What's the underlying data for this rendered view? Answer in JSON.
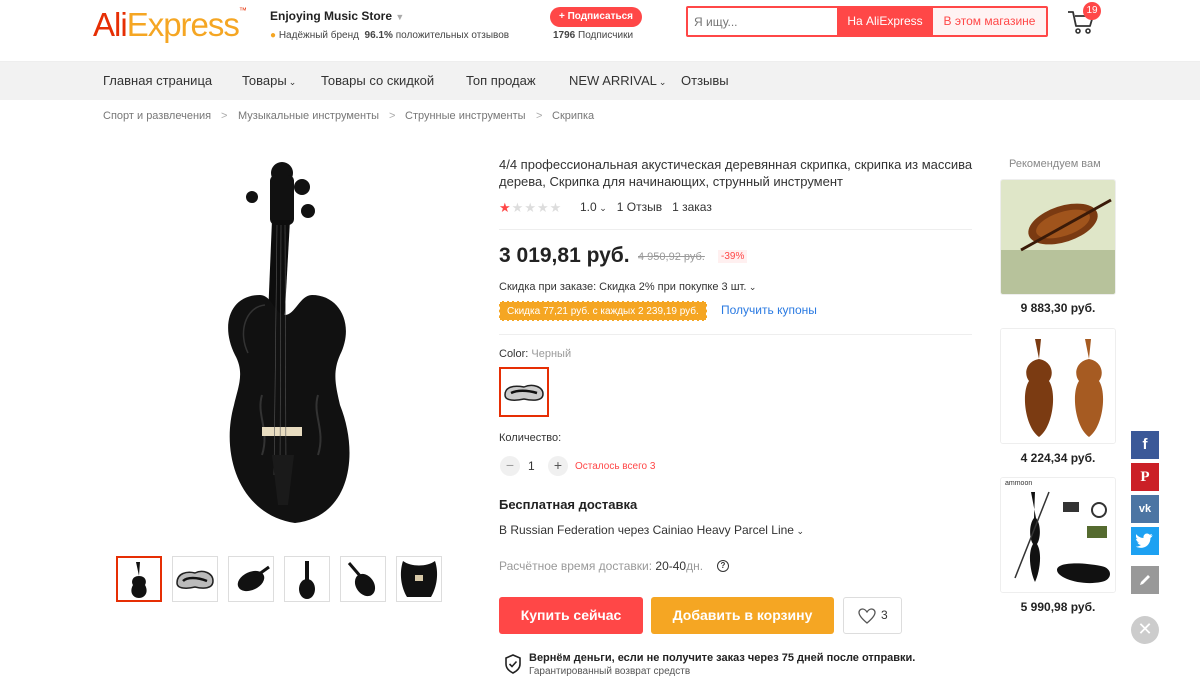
{
  "header": {
    "logo_part1": "Ali",
    "logo_part2": "Express",
    "store_name": "Enjoying Music Store",
    "badge_text": "Надёжный бренд",
    "rating_pct": "96.1%",
    "rating_label": "положительных отзывов",
    "subscribe_label": "+ Подписаться",
    "subscribers_count": "1796",
    "subscribers_label": "Подписчики",
    "search_placeholder": "Я ищу...",
    "search_btn_ali": "На AliExpress",
    "search_btn_store": "В этом магазине",
    "cart_count": "19"
  },
  "nav": [
    "Главная страница",
    "Товары",
    "Товары со скидкой",
    "Топ продаж",
    "NEW ARRIVAL",
    "Отзывы"
  ],
  "breadcrumb": [
    "Спорт и развлечения",
    "Музыкальные инструменты",
    "Струнные инструменты",
    "Скрипка"
  ],
  "product": {
    "title": "4/4 профессиональная акустическая деревянная скрипка, скрипка из массива дерева, Скрипка для начинающих, струнный инструмент",
    "rating_value": 1.0,
    "rating_text": "1.0",
    "reviews": "1 Отзыв",
    "orders": "1 заказ",
    "price": "3 019,81 руб.",
    "old_price": "4 950,92 руб.",
    "discount": "-39%",
    "order_discount": "Скидка при заказе: Скидка 2% при покупке 3 шт.",
    "coupon": "Скидка 77,21 руб. с каждых 2 239,19 руб.",
    "get_coupons": "Получить купоны",
    "color_label": "Color:",
    "color_value": "Черный",
    "qty_label": "Количество:",
    "qty_value": "1",
    "stock": "Осталось всего 3",
    "shipping_title": "Бесплатная доставка",
    "shipping_line": "В Russian Federation через Cainiao Heavy Parcel Line",
    "eta_label": "Расчётное время доставки:",
    "eta_value": "20-40",
    "eta_unit": "дн.",
    "buy_now": "Купить сейчас",
    "add_to_cart": "Добавить в корзину",
    "wishlist_count": "3",
    "guarantee_line1": "Вернём деньги, если не получите заказ через 75 дней после отправки.",
    "guarantee_line2": "Гарантированный возврат средств"
  },
  "recommend": {
    "title": "Рекомендуем вам",
    "items": [
      {
        "price": "9 883,30 руб."
      },
      {
        "price": "4 224,34 руб."
      },
      {
        "price": "5 990,98 руб.",
        "brand": "ammoon"
      }
    ]
  },
  "colors": {
    "accent": "#ff4747",
    "logo_red": "#e62e04",
    "logo_orange": "#f5a623",
    "link": "#2a7ae2",
    "facebook": "#3b5998",
    "pinterest": "#cb2027",
    "vk": "#4c75a3",
    "twitter": "#1da1f2",
    "edit": "#999999"
  },
  "social_icons": [
    "facebook-icon",
    "pinterest-icon",
    "vk-icon",
    "twitter-icon",
    "pencil-icon",
    "close-icon"
  ]
}
